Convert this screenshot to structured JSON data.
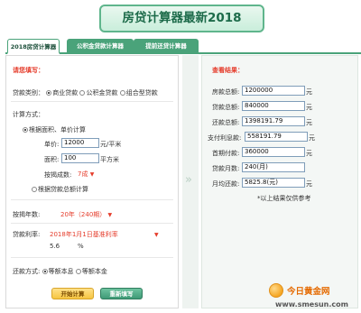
{
  "page_title": "房贷计算器最新2018",
  "tabs": [
    {
      "label": "2018房贷计算器"
    },
    {
      "label": "公积金贷款计算器"
    },
    {
      "label": "提前还贷计算器"
    }
  ],
  "form": {
    "heading": "请您填写：",
    "loan_type": {
      "label": "贷款类别：",
      "options": [
        "商业贷款",
        "公积金贷款",
        "组合型贷款"
      ]
    },
    "calc_method": {
      "label": "计算方式：",
      "option_area": "根据面积、单价计算",
      "unit_price_label": "单价:",
      "unit_price_value": "12000",
      "unit_price_unit": "元/平米",
      "area_label": "面积:",
      "area_value": "100",
      "area_unit": "平方米",
      "ratio_label": "按揭成数:",
      "ratio_value": "7成",
      "option_total": "根据贷款总额计算"
    },
    "years": {
      "label": "按揭年数:",
      "value": "20年（240期）"
    },
    "rate": {
      "label": "贷款利率:",
      "value": "2018年1月1日基准利率",
      "number": "5.6",
      "unit": "%"
    },
    "repay": {
      "label": "还款方式:",
      "options": [
        "等额本息",
        "等额本金"
      ]
    },
    "buttons": {
      "calc": "开始计算",
      "reset": "重新填写"
    }
  },
  "results": {
    "heading": "查看结果：",
    "rows": [
      {
        "label": "房款总额:",
        "value": "1200000",
        "unit": "元"
      },
      {
        "label": "贷款总额:",
        "value": "840000",
        "unit": "元"
      },
      {
        "label": "还款总额:",
        "value": "1398191.79",
        "unit": "元"
      },
      {
        "label": "支付利息款:",
        "value": "558191.79",
        "unit": "元"
      },
      {
        "label": "首期付款:",
        "value": "360000",
        "unit": "元"
      },
      {
        "label": "贷款月数:",
        "value": "240(月)",
        "unit": ""
      },
      {
        "label": "月均还款:",
        "value": "5825.8(元)",
        "unit": "元"
      }
    ],
    "note": "*以上结果仅供参考"
  },
  "watermark": {
    "name": "今日黄金网",
    "url": "www.smesun.com"
  }
}
